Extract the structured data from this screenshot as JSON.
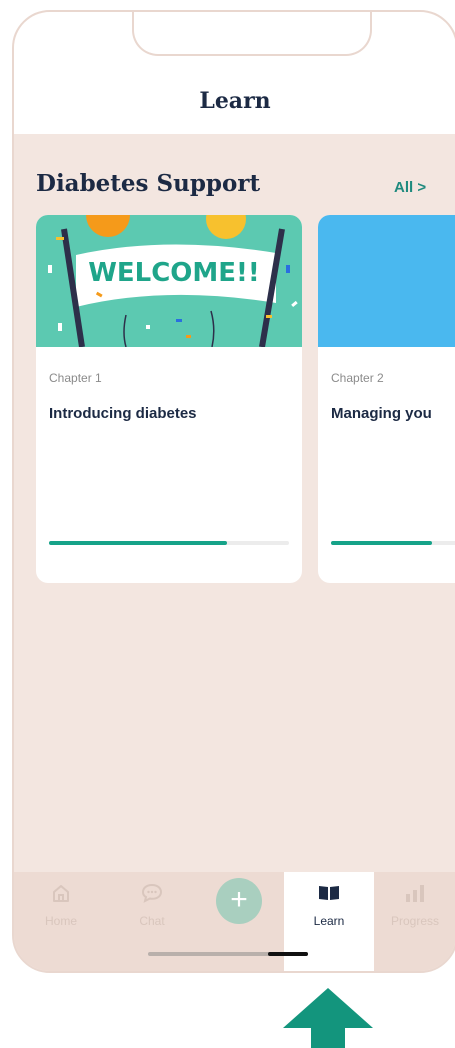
{
  "header": {
    "title": "Learn"
  },
  "section": {
    "title": "Diabetes Support",
    "all_label": "All >"
  },
  "cards": [
    {
      "chapter": "Chapter 1",
      "title": "Introducing diabetes",
      "banner_text": "WELCOME!!",
      "progress": 0.74
    },
    {
      "chapter": "Chapter 2",
      "title": "Managing you",
      "progress": 0.42
    }
  ],
  "tabs": {
    "home": "Home",
    "chat": "Chat",
    "add": "+",
    "learn": "Learn",
    "progress": "Progress"
  },
  "colors": {
    "accent": "#16a389",
    "navy": "#1c2a44",
    "background": "#f3e6e0",
    "arrow": "#13957d"
  }
}
